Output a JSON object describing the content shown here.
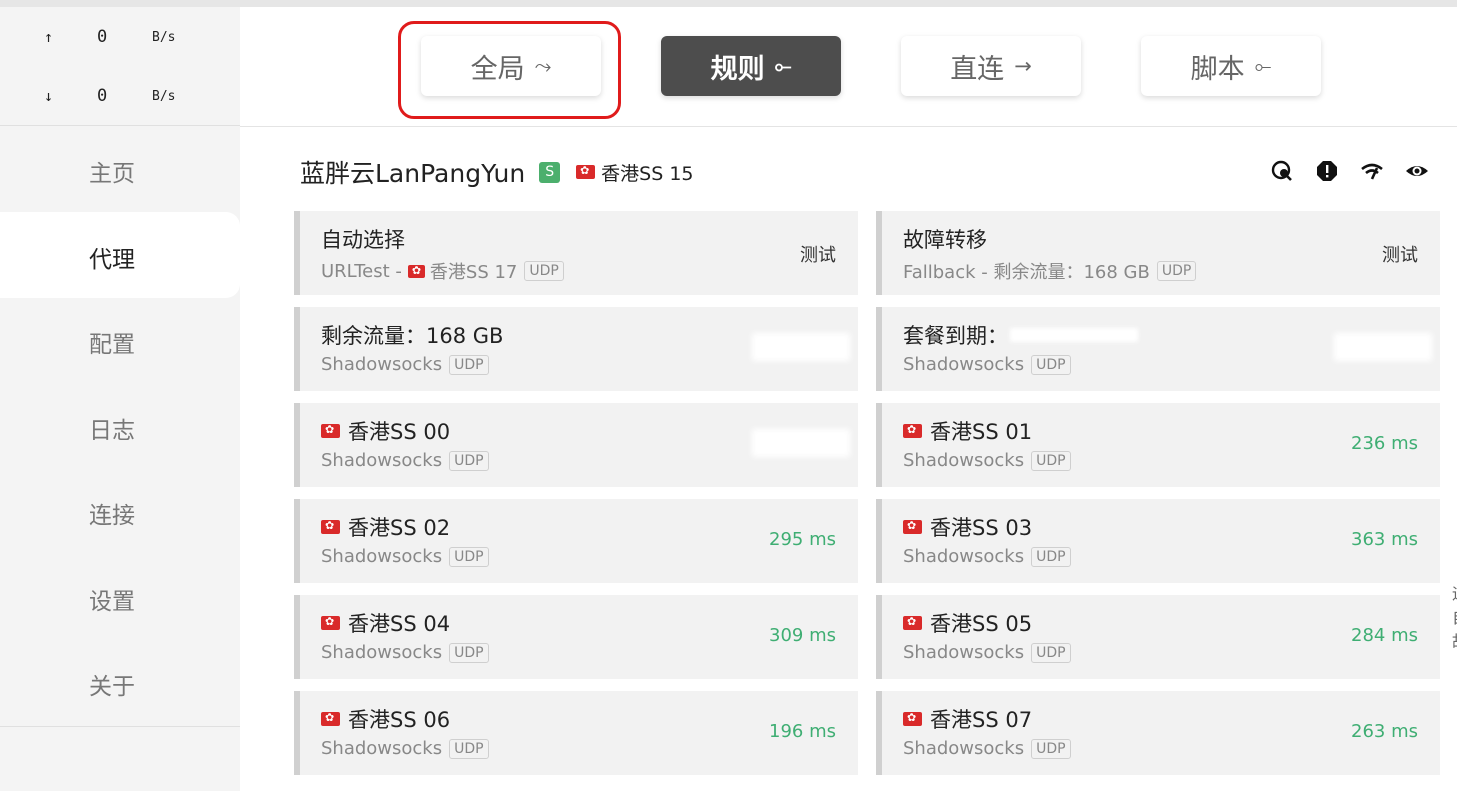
{
  "traffic": {
    "up": {
      "arrow": "↑",
      "value": "0",
      "unit": "B/s"
    },
    "down": {
      "arrow": "↓",
      "value": "0",
      "unit": "B/s"
    }
  },
  "nav": [
    "主页",
    "代理",
    "配置",
    "日志",
    "连接",
    "设置",
    "关于"
  ],
  "nav_active": "代理",
  "modes": [
    {
      "label": "全局",
      "icon": "⤳"
    },
    {
      "label": "规则",
      "icon": "⟜"
    },
    {
      "label": "直连",
      "icon": "→"
    },
    {
      "label": "脚本",
      "icon": "⟜"
    }
  ],
  "group": {
    "name": "蓝胖云LanPangYun",
    "type_badge": "S",
    "selected": "香港SS 15",
    "tool_icons": [
      "search-network-icon",
      "alert-icon",
      "wifi-speed-icon",
      "eye-icon"
    ]
  },
  "cards": [
    {
      "name": "自动选择",
      "sub_type": "URLTest - ",
      "sub_node": "香港SS 17",
      "udp": "UDP",
      "right": "测试",
      "flag": false,
      "sub_flag": true
    },
    {
      "name": "故障转移",
      "sub_type": "Fallback - 剩余流量：168 GB",
      "sub_node": "",
      "udp": "UDP",
      "right": "测试",
      "flag": false,
      "sub_flag": false
    },
    {
      "name": "剩余流量：168 GB",
      "sub_type": "Shadowsocks",
      "udp": "UDP",
      "right": "",
      "flag": false,
      "masked": true
    },
    {
      "name": "套餐到期：",
      "sub_type": "Shadowsocks",
      "udp": "UDP",
      "right": "",
      "flag": false,
      "masked": true,
      "title_masked": true
    },
    {
      "name": "香港SS 00",
      "sub_type": "Shadowsocks",
      "udp": "UDP",
      "right": "",
      "flag": true,
      "masked": true
    },
    {
      "name": "香港SS 01",
      "sub_type": "Shadowsocks",
      "udp": "UDP",
      "right": "236 ms",
      "flag": true
    },
    {
      "name": "香港SS 02",
      "sub_type": "Shadowsocks",
      "udp": "UDP",
      "right": "295 ms",
      "flag": true
    },
    {
      "name": "香港SS 03",
      "sub_type": "Shadowsocks",
      "udp": "UDP",
      "right": "363 ms",
      "flag": true
    },
    {
      "name": "香港SS 04",
      "sub_type": "Shadowsocks",
      "udp": "UDP",
      "right": "309 ms",
      "flag": true
    },
    {
      "name": "香港SS 05",
      "sub_type": "Shadowsocks",
      "udp": "UDP",
      "right": "284 ms",
      "flag": true
    },
    {
      "name": "香港SS 06",
      "sub_type": "Shadowsocks",
      "udp": "UDP",
      "right": "196 ms",
      "flag": true
    },
    {
      "name": "香港SS 07",
      "sub_type": "Shadowsocks",
      "udp": "UDP",
      "right": "263 ms",
      "flag": true
    }
  ],
  "colors": {
    "latency": "#3fae73",
    "highlight": "#e01b1b",
    "active_mode": "#4d4d4d"
  }
}
